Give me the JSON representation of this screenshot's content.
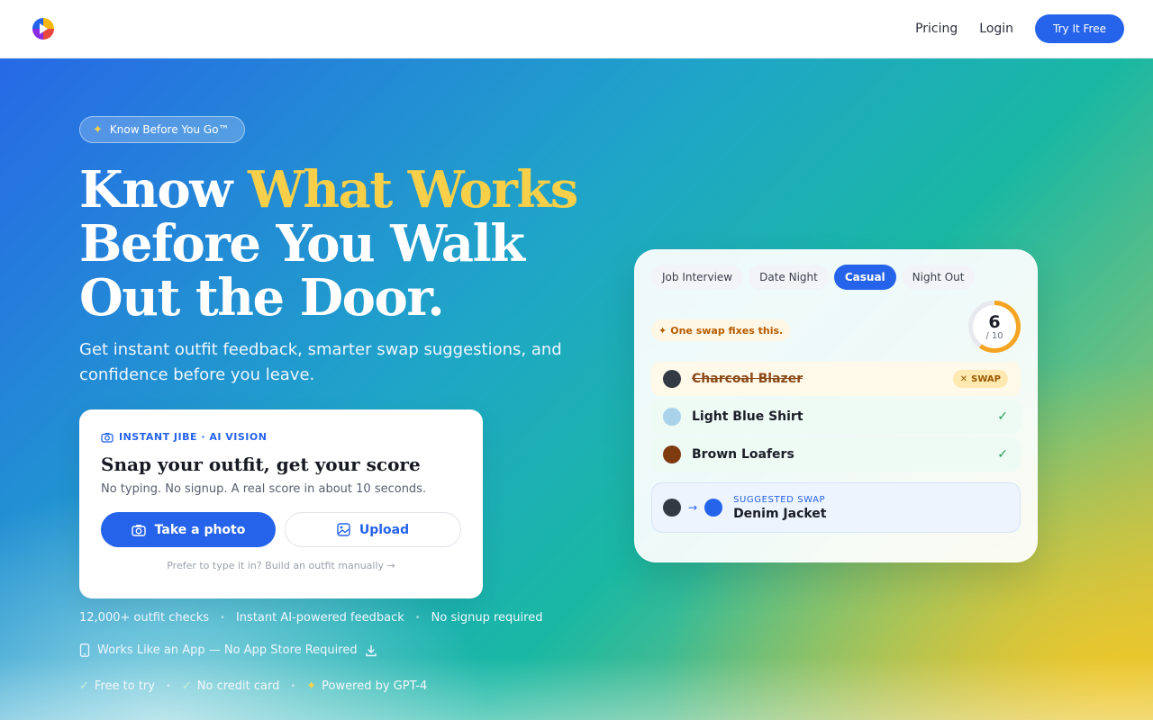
{
  "header": {
    "logo": "app-logo",
    "nav": [
      "Pricing",
      "Login"
    ],
    "cta": "Try It Free"
  },
  "hero": {
    "badge": "Know Before You Go™",
    "headline_a": "Know ",
    "headline_accent": "What Works",
    "headline_b": "Before You Walk Out the Door.",
    "subtitle": "Get instant outfit feedback, smarter swap suggestions, and confidence before you leave."
  },
  "snap": {
    "eyebrow": "INSTANT JIBE · AI VISION",
    "title": "Snap your outfit, get your score",
    "description": "No typing. No signup. A real score in about 10 seconds.",
    "take_photo": "Take a photo",
    "upload": "Upload",
    "manual": "Prefer to type it in? Build an outfit manually →"
  },
  "stats": [
    "12,000+ outfit checks",
    "Instant AI-powered feedback",
    "No signup required"
  ],
  "app_link": "Works Like an App — No App Store Required",
  "free_bar": [
    "Free to try",
    "No credit card",
    "Powered by GPT-4"
  ],
  "demo": {
    "tabs": [
      "Job Interview",
      "Date Night",
      "Casual",
      "Night Out"
    ],
    "active_tab": "Casual",
    "swap_note": "One swap fixes this.",
    "score": "6",
    "score_max": "/ 10",
    "score_fraction": 0.6,
    "items": [
      {
        "name": "Charcoal Blazer",
        "color": "#343a43",
        "status": "swap",
        "tag": "SWAP"
      },
      {
        "name": "Light Blue Shirt",
        "color": "#a9d3ea",
        "status": "ok"
      },
      {
        "name": "Brown Loafers",
        "color": "#7f3a10",
        "status": "ok"
      }
    ],
    "suggested_label": "SUGGESTED SWAP",
    "suggested_name": "Denim Jacket",
    "suggest_from_color": "#343a43",
    "suggest_to_color": "#2563eb"
  },
  "colors": {
    "accent": "#2563eb",
    "headline_accent": "#f7cf48"
  }
}
